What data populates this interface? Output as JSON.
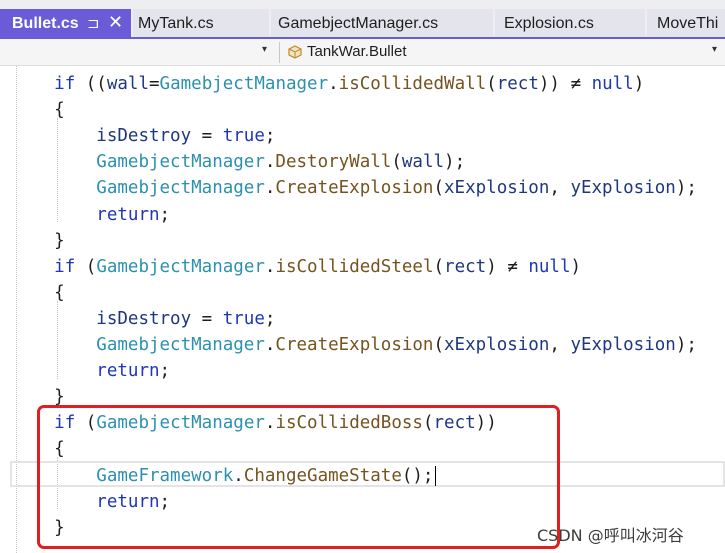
{
  "tabs": [
    {
      "label": "Bullet.cs",
      "active": true,
      "pin": "⊐",
      "close": "✕"
    },
    {
      "label": "MyTank.cs",
      "active": false
    },
    {
      "label": "GamebjectManager.cs",
      "active": false
    },
    {
      "label": "Explosion.cs",
      "active": false
    },
    {
      "label": "MoveThi",
      "active": false
    }
  ],
  "navigation": {
    "member_dropdown_arrow": "▾",
    "class_path": "TankWar.Bullet",
    "type_dropdown_arrow": "▾"
  },
  "code_lines": [
    [
      {
        "t": "    ",
        "c": "p"
      },
      {
        "t": "if",
        "c": "kw"
      },
      {
        "t": " ((",
        "c": "p"
      },
      {
        "t": "wall",
        "c": "var"
      },
      {
        "t": "=",
        "c": "p"
      },
      {
        "t": "GamebjectManager",
        "c": "cls"
      },
      {
        "t": ".",
        "c": "p"
      },
      {
        "t": "isCollidedWall",
        "c": "fn"
      },
      {
        "t": "(",
        "c": "p"
      },
      {
        "t": "rect",
        "c": "var"
      },
      {
        "t": ")) ≠ ",
        "c": "p"
      },
      {
        "t": "null",
        "c": "kw"
      },
      {
        "t": ")",
        "c": "p"
      }
    ],
    [
      {
        "t": "    {",
        "c": "p"
      }
    ],
    [
      {
        "t": "        ",
        "c": "p"
      },
      {
        "t": "isDestroy",
        "c": "var"
      },
      {
        "t": " = ",
        "c": "p"
      },
      {
        "t": "true",
        "c": "kw"
      },
      {
        "t": ";",
        "c": "p"
      }
    ],
    [
      {
        "t": "        ",
        "c": "p"
      },
      {
        "t": "GamebjectManager",
        "c": "cls"
      },
      {
        "t": ".",
        "c": "p"
      },
      {
        "t": "DestoryWall",
        "c": "fn"
      },
      {
        "t": "(",
        "c": "p"
      },
      {
        "t": "wall",
        "c": "var"
      },
      {
        "t": ");",
        "c": "p"
      }
    ],
    [
      {
        "t": "        ",
        "c": "p"
      },
      {
        "t": "GamebjectManager",
        "c": "cls"
      },
      {
        "t": ".",
        "c": "p"
      },
      {
        "t": "CreateExplosion",
        "c": "fn"
      },
      {
        "t": "(",
        "c": "p"
      },
      {
        "t": "xExplosion",
        "c": "var"
      },
      {
        "t": ", ",
        "c": "p"
      },
      {
        "t": "yExplosion",
        "c": "var"
      },
      {
        "t": ");",
        "c": "p"
      }
    ],
    [
      {
        "t": "        ",
        "c": "p"
      },
      {
        "t": "return",
        "c": "kw"
      },
      {
        "t": ";",
        "c": "p"
      }
    ],
    [
      {
        "t": "    }",
        "c": "p"
      }
    ],
    [
      {
        "t": "    ",
        "c": "p"
      },
      {
        "t": "if",
        "c": "kw"
      },
      {
        "t": " (",
        "c": "p"
      },
      {
        "t": "GamebjectManager",
        "c": "cls"
      },
      {
        "t": ".",
        "c": "p"
      },
      {
        "t": "isCollidedSteel",
        "c": "fn"
      },
      {
        "t": "(",
        "c": "p"
      },
      {
        "t": "rect",
        "c": "var"
      },
      {
        "t": ") ≠ ",
        "c": "p"
      },
      {
        "t": "null",
        "c": "kw"
      },
      {
        "t": ")",
        "c": "p"
      }
    ],
    [
      {
        "t": "    {",
        "c": "p"
      }
    ],
    [
      {
        "t": "        ",
        "c": "p"
      },
      {
        "t": "isDestroy",
        "c": "var"
      },
      {
        "t": " = ",
        "c": "p"
      },
      {
        "t": "true",
        "c": "kw"
      },
      {
        "t": ";",
        "c": "p"
      }
    ],
    [
      {
        "t": "        ",
        "c": "p"
      },
      {
        "t": "GamebjectManager",
        "c": "cls"
      },
      {
        "t": ".",
        "c": "p"
      },
      {
        "t": "CreateExplosion",
        "c": "fn"
      },
      {
        "t": "(",
        "c": "p"
      },
      {
        "t": "xExplosion",
        "c": "var"
      },
      {
        "t": ", ",
        "c": "p"
      },
      {
        "t": "yExplosion",
        "c": "var"
      },
      {
        "t": ");",
        "c": "p"
      }
    ],
    [
      {
        "t": "        ",
        "c": "p"
      },
      {
        "t": "return",
        "c": "kw"
      },
      {
        "t": ";",
        "c": "p"
      }
    ],
    [
      {
        "t": "    }",
        "c": "p"
      }
    ],
    [
      {
        "t": "    ",
        "c": "p"
      },
      {
        "t": "if",
        "c": "kw"
      },
      {
        "t": " (",
        "c": "p"
      },
      {
        "t": "GamebjectManager",
        "c": "cls"
      },
      {
        "t": ".",
        "c": "p"
      },
      {
        "t": "isCollidedBoss",
        "c": "fn"
      },
      {
        "t": "(",
        "c": "p"
      },
      {
        "t": "rect",
        "c": "var"
      },
      {
        "t": "))",
        "c": "p"
      }
    ],
    [
      {
        "t": "    {",
        "c": "p"
      }
    ],
    [
      {
        "t": "        ",
        "c": "p"
      },
      {
        "t": "GameFramework",
        "c": "cls"
      },
      {
        "t": ".",
        "c": "p"
      },
      {
        "t": "ChangeGameState",
        "c": "fn"
      },
      {
        "t": "();",
        "c": "p"
      }
    ],
    [
      {
        "t": "        ",
        "c": "p"
      },
      {
        "t": "return",
        "c": "kw"
      },
      {
        "t": ";",
        "c": "p"
      }
    ],
    [
      {
        "t": "    }",
        "c": "p"
      }
    ]
  ],
  "colors": {
    "keyword": "#1f36b8",
    "class": "#2b91af",
    "method": "#74531f",
    "variable": "#1f377f",
    "highlight_box": "#e02020",
    "active_tab": "#6b5bd6"
  },
  "watermark": "CSDN @呼叫冰河谷"
}
